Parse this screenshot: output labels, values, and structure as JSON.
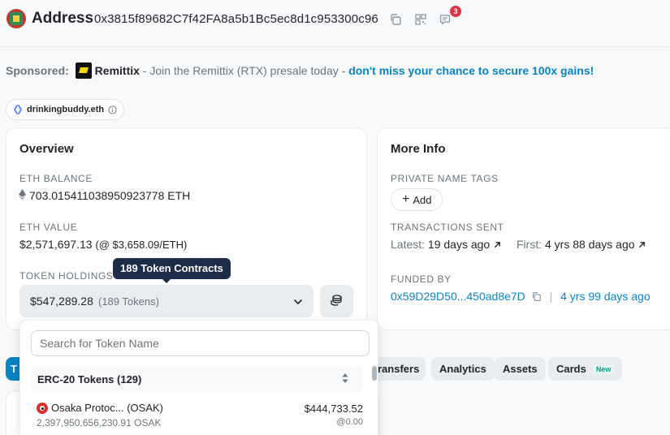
{
  "header": {
    "title": "Address",
    "address": "0x3815f89682C7f42FA8a5b1Bc5ec8d1c953300c96",
    "notification_count": "3"
  },
  "sponsored": {
    "label": "Sponsored:",
    "brand": "Remittix",
    "text": " - Join the Remittix (RTX) presale today - ",
    "cta": "don't miss your chance to secure 100x gains!"
  },
  "ens": {
    "name": "drinkingbuddy.eth"
  },
  "overview": {
    "title": "Overview",
    "eth_balance_label": "ETH BALANCE",
    "eth_balance_value": "703.015411038950923778 ETH",
    "eth_value_label": "ETH VALUE",
    "eth_value": "$2,571,697.13",
    "eth_price": "(@ $3,658.09/ETH)",
    "token_holdings_label": "TOKEN HOLDINGS",
    "tooltip": "189 Token Contracts",
    "token_value": "$547,289.28",
    "token_count": "(189 Tokens)"
  },
  "dropdown": {
    "search_placeholder": "Search for Token Name",
    "group_label": "ERC-20 Tokens (129)",
    "tokens": [
      {
        "name": "Osaka Protoc... (OSAK)",
        "value": "$444,733.52",
        "amount": "2,397,950,656,230.91 OSAK",
        "price": "@0.00"
      }
    ]
  },
  "more_info": {
    "title": "More Info",
    "private_tags_label": "PRIVATE NAME TAGS",
    "add_label": "Add",
    "tx_sent_label": "TRANSACTIONS SENT",
    "latest_label": "Latest:",
    "latest_value": "19 days ago",
    "first_label": "First:",
    "first_value": "4 yrs 88 days ago",
    "funded_by_label": "FUNDED BY",
    "funded_by_address": "0x59D29D50...450ad8e7D",
    "funded_by_age": "4 yrs 99 days ago"
  },
  "tabs": [
    {
      "label": "T"
    },
    {
      "label": "ransfers"
    },
    {
      "label": "Analytics"
    },
    {
      "label": "Assets"
    },
    {
      "label": "Cards",
      "badge": "New"
    }
  ],
  "colors": {
    "accent": "#0784c3",
    "tooltip_bg": "#1c2b46",
    "badge_red": "#dc3545"
  }
}
